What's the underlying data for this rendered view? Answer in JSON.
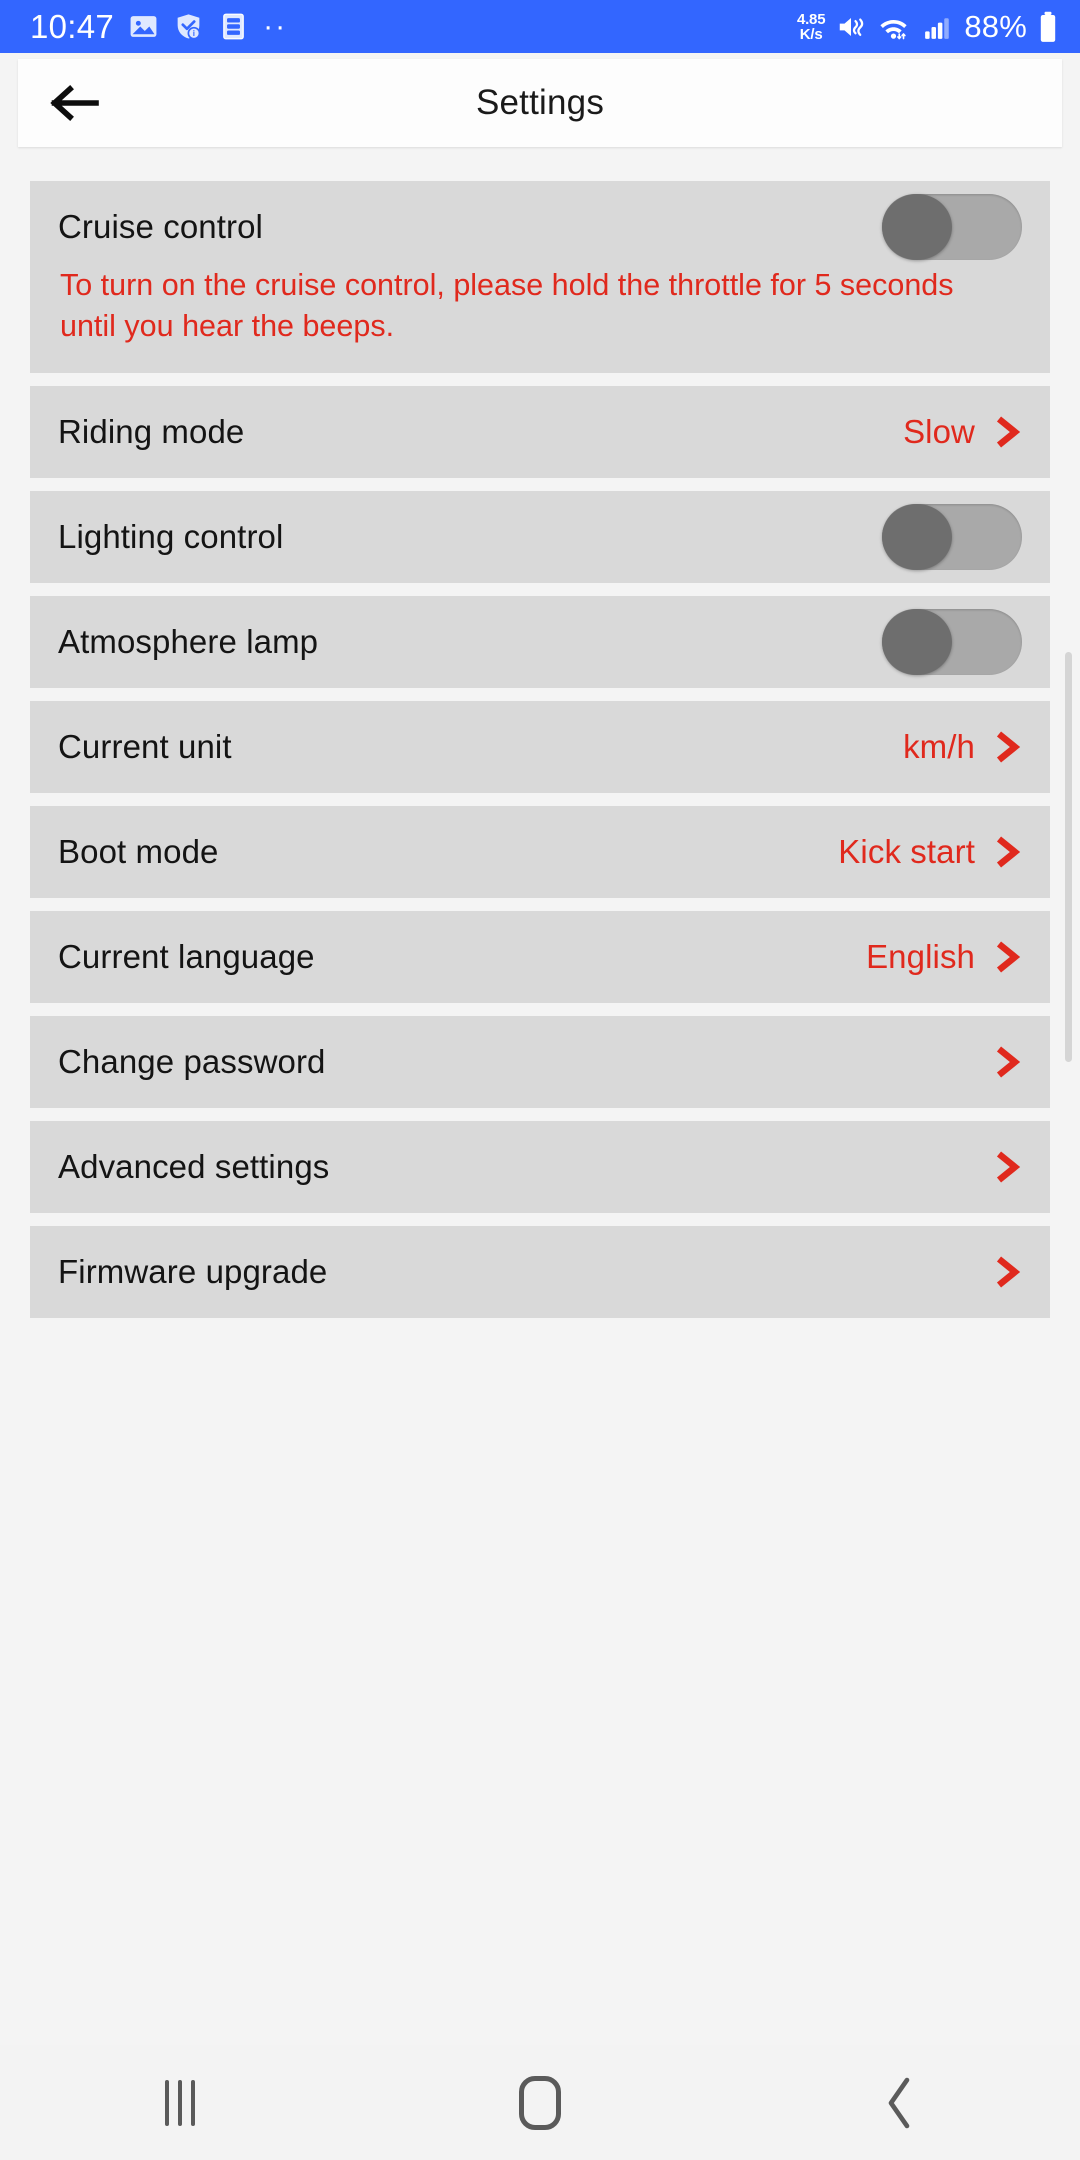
{
  "status_bar": {
    "time": "10:47",
    "left_icons": [
      "image-icon",
      "shield-check-icon",
      "list-document-icon",
      "more-dots-icon"
    ],
    "data_rate_value": "4.85",
    "data_rate_unit": "K/s",
    "right_icons": [
      "vibrate-icon",
      "wifi-icon",
      "signal-bars-icon"
    ],
    "battery_percent": "88%",
    "background_color": "#3366ff"
  },
  "header": {
    "title": "Settings",
    "back_icon": "arrow-left-icon"
  },
  "theme": {
    "accent_red": "#e0291d",
    "row_background": "#d9d9d9",
    "page_background": "#f4f4f4"
  },
  "rows": [
    {
      "label": "Cruise control",
      "type": "toggle",
      "toggle_state": "off",
      "note": "To turn on the cruise control, please hold the throttle for 5 seconds until you hear the beeps."
    },
    {
      "label": "Riding mode",
      "type": "value",
      "value": "Slow"
    },
    {
      "label": "Lighting control",
      "type": "toggle",
      "toggle_state": "off"
    },
    {
      "label": "Atmosphere lamp",
      "type": "toggle",
      "toggle_state": "off"
    },
    {
      "label": "Current unit",
      "type": "value",
      "value": "km/h"
    },
    {
      "label": "Boot mode",
      "type": "value",
      "value": "Kick start"
    },
    {
      "label": "Current language",
      "type": "value",
      "value": "English"
    },
    {
      "label": "Change password",
      "type": "value",
      "value": ""
    },
    {
      "label": "Advanced settings",
      "type": "value",
      "value": ""
    },
    {
      "label": "Firmware upgrade",
      "type": "value",
      "value": ""
    }
  ],
  "nav_bar": {
    "recent_label": "recent-apps",
    "home_label": "home",
    "back_label": "back"
  }
}
